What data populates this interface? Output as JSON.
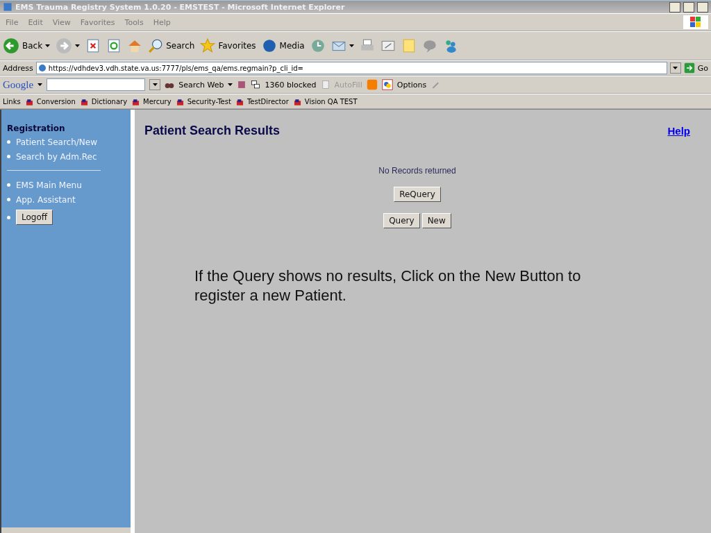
{
  "window": {
    "title": "EMS Trauma Registry System 1.0.20 - EMSTEST - Microsoft Internet Explorer"
  },
  "menu": [
    "File",
    "Edit",
    "View",
    "Favorites",
    "Tools",
    "Help"
  ],
  "toolbar": [
    {
      "kind": "back",
      "label": "Back"
    },
    {
      "kind": "forward"
    },
    {
      "kind": "stop"
    },
    {
      "kind": "refresh"
    },
    {
      "kind": "home"
    },
    {
      "kind": "search",
      "label": "Search"
    },
    {
      "kind": "favorites",
      "label": "Favorites"
    },
    {
      "kind": "media",
      "label": "Media"
    },
    {
      "kind": "history"
    },
    {
      "kind": "mail"
    },
    {
      "kind": "print"
    },
    {
      "kind": "edit"
    },
    {
      "kind": "note"
    },
    {
      "kind": "discuss"
    },
    {
      "kind": "messenger"
    }
  ],
  "address": {
    "label": "Address",
    "value": "https://vdhdev3.vdh.state.va.us:7777/pls/ems_qa/ems.regmain?p_cli_id=",
    "go": "Go"
  },
  "google": {
    "logo": "Google",
    "search_web": "Search Web",
    "blocked": "1360 blocked",
    "autofill": "AutoFill",
    "options": "Options"
  },
  "links": {
    "label": "Links",
    "items": [
      "Conversion",
      "Dictionary",
      "Mercury",
      "Security-Test",
      "TestDirector",
      "Vision QA TEST"
    ]
  },
  "sidebar": {
    "heading": "Registration",
    "group1": [
      "Patient Search/New",
      "Search by Adm.Rec"
    ],
    "group2": [
      "EMS Main Menu",
      "App. Assistant"
    ],
    "logoff": "Logoff"
  },
  "main": {
    "title": "Patient Search Results",
    "help": "Help",
    "message": "No Records returned",
    "requery": "ReQuery",
    "buttons": [
      "Query",
      "New"
    ],
    "note": "If the Query shows no results, Click on the New Button to register a new Patient."
  }
}
